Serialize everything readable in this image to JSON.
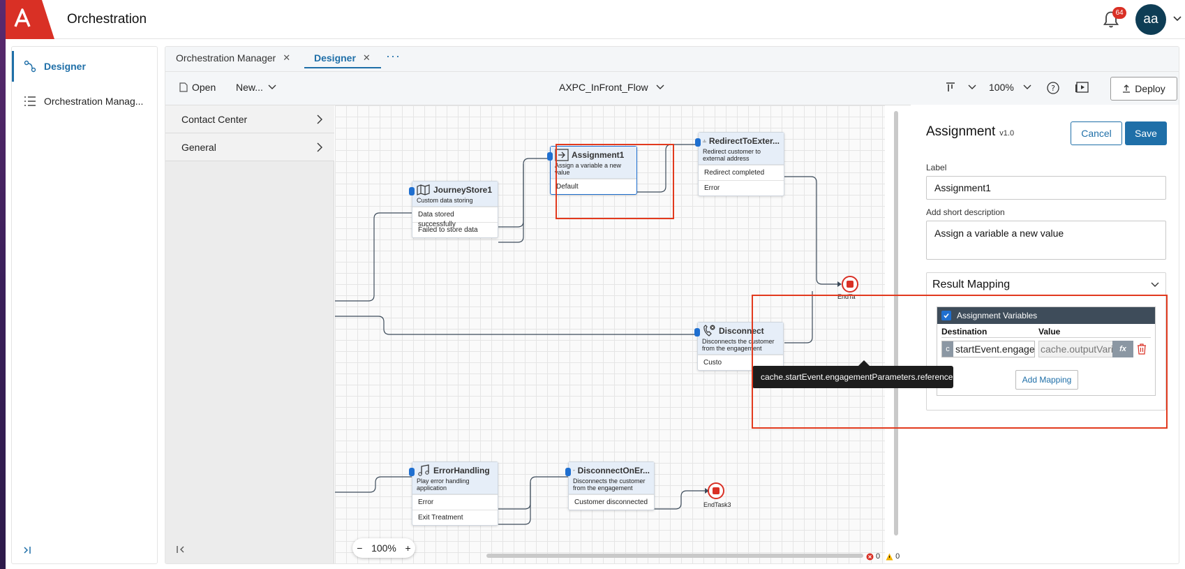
{
  "app": {
    "title": "Orchestration",
    "notification_count": "64",
    "user_initials": "aa"
  },
  "colors": {
    "accent": "#1f6fa8",
    "brand_red": "#d93025",
    "highlight": "#e23a1e",
    "avatar_bg": "#0e3d55"
  },
  "leftnav": {
    "items": [
      {
        "label": "Designer",
        "icon": "flow-icon",
        "active": true
      },
      {
        "label": "Orchestration Manag...",
        "icon": "list-icon",
        "active": false
      }
    ]
  },
  "tabs": [
    {
      "label": "Orchestration Manager",
      "active": false
    },
    {
      "label": "Designer",
      "active": true
    }
  ],
  "toolbar": {
    "open_label": "Open",
    "new_label": "New...",
    "flow_name": "AXPC_InFront_Flow",
    "zoom": "100%",
    "deploy_label": "Deploy"
  },
  "palette": [
    {
      "label": "Contact Center"
    },
    {
      "label": "General"
    }
  ],
  "nodes": {
    "journey": {
      "title": "JourneyStore1",
      "desc": "Custom data storing",
      "outputs": [
        "Data stored successfully",
        "Failed to store data"
      ]
    },
    "assignment": {
      "title": "Assignment1",
      "desc": "Assign a variable a new value",
      "outputs": [
        "Default"
      ]
    },
    "redirect": {
      "title": "RedirectToExter...",
      "desc": "Redirect customer to external address",
      "outputs": [
        "Redirect completed",
        "Error"
      ]
    },
    "disconnect": {
      "title": "Disconnect",
      "desc": "Disconnects the customer from the engagement",
      "outputs": [
        "Custo"
      ]
    },
    "errorhandling": {
      "title": "ErrorHandling",
      "desc": "Play error handling application",
      "outputs": [
        "Error",
        "Exit Treatment"
      ]
    },
    "disconnect_err": {
      "title": "DisconnectOnEr...",
      "desc": "Disconnects the customer from the engagement",
      "outputs": [
        "Customer disconnected"
      ]
    },
    "end_task": {
      "label": "EndTa"
    },
    "end_task3": {
      "label": "EndTask3"
    }
  },
  "canvas": {
    "zoom": "100%",
    "error_count": "0",
    "warning_count": "0",
    "tooltip": "cache.startEvent.engagementParameters.reference"
  },
  "props": {
    "title": "Assignment",
    "version": "v1.0",
    "cancel_label": "Cancel",
    "save_label": "Save",
    "label_field_label": "Label",
    "label_value": "Assignment1",
    "desc_field_label": "Add short description",
    "desc_value": "Assign a variable a new value",
    "section_title": "Result Mapping",
    "mapping": {
      "header": "Assignment Variables",
      "destination_header": "Destination",
      "value_header": "Value",
      "destination_prefix": "c",
      "destination_value": "startEvent.engage",
      "value_value": "cache.outputVaria",
      "fx_label": "fx",
      "add_label": "Add Mapping"
    }
  }
}
